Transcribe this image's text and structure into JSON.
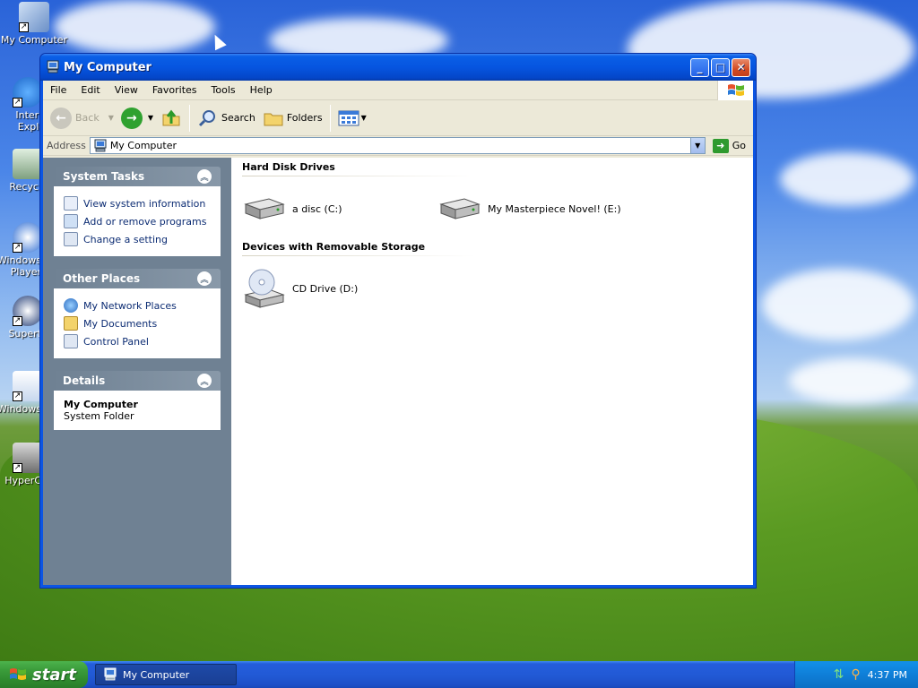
{
  "desktop": {
    "icons": [
      {
        "label": "My Computer",
        "icon": "my-computer-icon"
      },
      {
        "label": "Intern Explo",
        "icon": "internet-explorer-icon"
      },
      {
        "label": "Recycl",
        "icon": "recycle-bin-icon"
      },
      {
        "label": "Windows Player",
        "icon": "media-player-icon"
      },
      {
        "label": "Supert",
        "icon": "supertux-icon"
      },
      {
        "label": "Windows",
        "icon": "windows-icon"
      },
      {
        "label": "HyperC",
        "icon": "hyperterminal-icon"
      }
    ]
  },
  "window": {
    "title": "My Computer",
    "menu": [
      "File",
      "Edit",
      "View",
      "Favorites",
      "Tools",
      "Help"
    ],
    "toolbar": {
      "back_label": "Back",
      "search_label": "Search",
      "folders_label": "Folders"
    },
    "address": {
      "label": "Address",
      "value": "My Computer",
      "go_label": "Go"
    },
    "taskpane": {
      "system_tasks": {
        "title": "System Tasks",
        "items": [
          "View system information",
          "Add or remove programs",
          "Change a setting"
        ]
      },
      "other_places": {
        "title": "Other Places",
        "items": [
          "My Network Places",
          "My Documents",
          "Control Panel"
        ]
      },
      "details": {
        "title": "Details",
        "name": "My Computer",
        "type": "System Folder"
      }
    },
    "groups": {
      "hard_disks": {
        "title": "Hard Disk Drives",
        "drives": [
          "a disc (C:)",
          "My Masterpiece Novel! (E:)"
        ]
      },
      "removable": {
        "title": "Devices with Removable Storage",
        "drives": [
          "CD Drive (D:)"
        ]
      }
    }
  },
  "taskbar": {
    "start_label": "start",
    "task_label": "My Computer",
    "clock": "4:37 PM"
  },
  "colors": {
    "titlebar": "#0655e0",
    "taskpane": "#6f8193",
    "start": "#3c9e3c"
  }
}
